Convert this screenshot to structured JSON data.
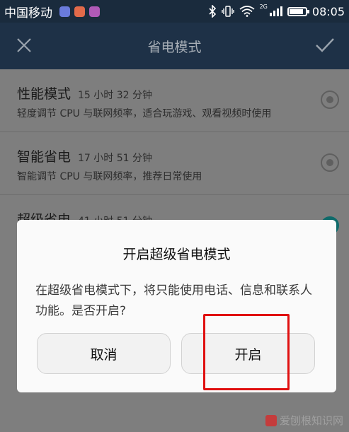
{
  "status_bar": {
    "carrier": "中国移动",
    "network_label": "2G",
    "time": "08:05",
    "app_icons": [
      {
        "name": "shield-app-icon",
        "color": "#6a7bdc"
      },
      {
        "name": "heart-app-icon",
        "color": "#e26a4a"
      },
      {
        "name": "gallery-app-icon",
        "color": "#b05ab8"
      }
    ],
    "battery_level": 0.85
  },
  "app_bar": {
    "title": "省电模式",
    "close_icon": "close-icon",
    "confirm_icon": "check-icon"
  },
  "modes": [
    {
      "name": "性能模式",
      "time": "15 小时 32 分钟",
      "desc": "轻度调节 CPU 与联网频率，适合玩游戏、观看视频时使用",
      "selected": false
    },
    {
      "name": "智能省电",
      "time": "17 小时 51 分钟",
      "desc": "智能调节 CPU 与联网频率，推荐日常使用",
      "selected": false
    },
    {
      "name": "超级省电",
      "time": "41 小时 51 分钟",
      "desc": "",
      "selected": true
    }
  ],
  "dialog": {
    "title": "开启超级省电模式",
    "message": "在超级省电模式下，将只能使用电话、信息和联系人功能。是否开启?",
    "cancel_label": "取消",
    "confirm_label": "开启"
  },
  "watermark": "爱刨根知识网",
  "colors": {
    "status_bar": "#1a2b3d",
    "app_bar": "#1e3147",
    "highlight": "#e01010",
    "radio_selected": "#0e6a6a"
  }
}
